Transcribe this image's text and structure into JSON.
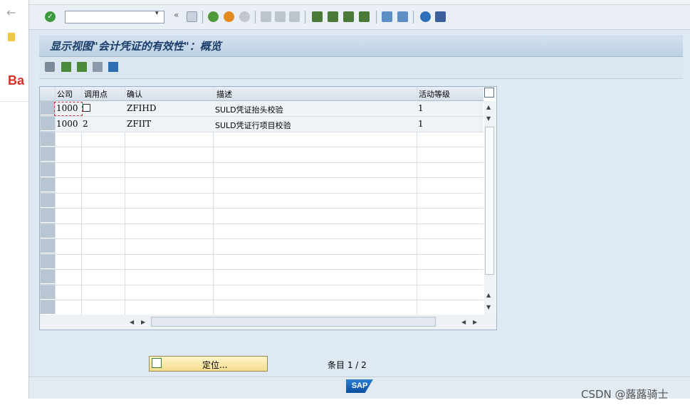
{
  "browser": {
    "back_icon": "arrow-left-icon",
    "bookmark_label": "Ba"
  },
  "toolbar": {
    "enter_icon": "check-icon",
    "command_value": "",
    "history_symbol": "«",
    "dropdown_symbol": "▾"
  },
  "title": "显示视图\"会计凭证的有效性\"：概览",
  "table": {
    "columns": [
      "公司",
      "调用点",
      "确认",
      "描述",
      "活动等级"
    ],
    "rows": [
      {
        "company": "1000",
        "call_point": "",
        "validation": "ZFIHD",
        "description": "SULD凭证抬头校验",
        "level": "1"
      },
      {
        "company": "1000",
        "call_point": "2",
        "validation": "ZFIIT",
        "description": "SULD凭证行项目校验",
        "level": "1"
      }
    ]
  },
  "bottom": {
    "position_label": "定位...",
    "entry_info": "条目 1 / 2"
  },
  "status": {
    "logo_text": "SAP"
  },
  "watermark": "CSDN @蕗蕗骑士"
}
